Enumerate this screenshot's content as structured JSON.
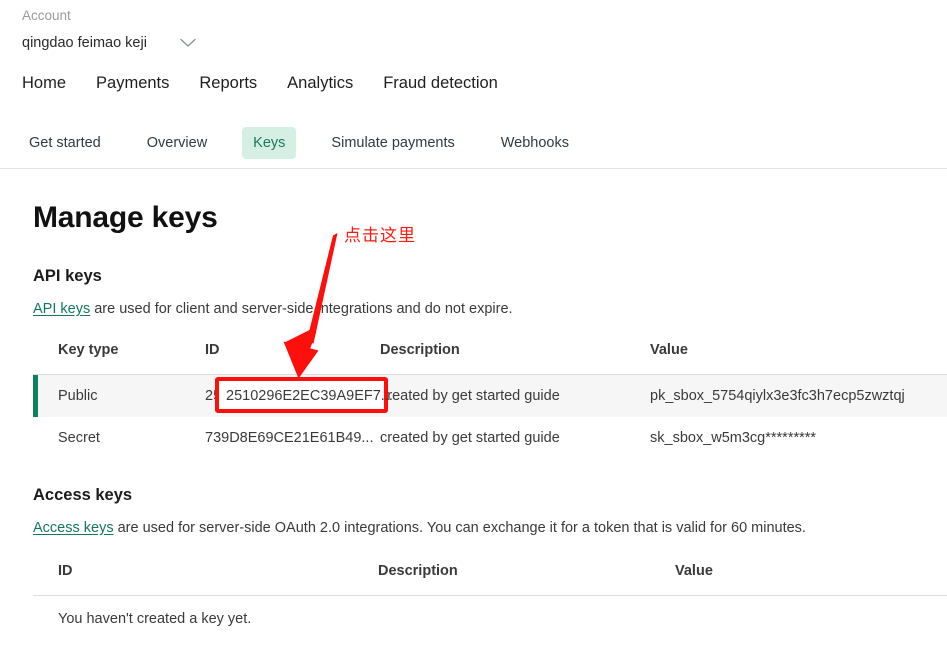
{
  "header": {
    "account_label": "Account",
    "account_name": "qingdao feimao keji",
    "chevron_icon": "chevron-down-icon"
  },
  "primary_nav": [
    {
      "label": "Home"
    },
    {
      "label": "Payments"
    },
    {
      "label": "Reports"
    },
    {
      "label": "Analytics"
    },
    {
      "label": "Fraud detection"
    }
  ],
  "tabs": [
    {
      "label": "Get started",
      "active": false
    },
    {
      "label": "Overview",
      "active": false
    },
    {
      "label": "Keys",
      "active": true
    },
    {
      "label": "Simulate payments",
      "active": false
    },
    {
      "label": "Webhooks",
      "active": false
    }
  ],
  "page_title": "Manage keys",
  "api_keys": {
    "section_title": "API keys",
    "desc_link": "API keys",
    "desc_rest": " are used for client and server-side integrations and do not expire.",
    "columns": {
      "key_type": "Key type",
      "id": "ID",
      "description": "Description",
      "value": "Value"
    },
    "rows": [
      {
        "key_type": "Public",
        "id": "2510296E2EC39A9EF7...",
        "description": "created by get started guide",
        "value": "pk_sbox_5754qiylx3e3fc3h7ecp5zwztqj",
        "highlighted": true
      },
      {
        "key_type": "Secret",
        "id": "739D8E69CE21E61B49...",
        "description": "created by get started guide",
        "value": "sk_sbox_w5m3cg*********",
        "highlighted": false
      }
    ]
  },
  "access_keys": {
    "section_title": "Access keys",
    "desc_link": "Access keys",
    "desc_rest": " are used for server-side OAuth 2.0 integrations. You can exchange it for a token that is valid for 60 minutes.",
    "columns": {
      "id": "ID",
      "description": "Description",
      "value": "Value"
    },
    "empty_message": "You haven't created a key yet."
  },
  "annotation": {
    "text": "点击这里",
    "arrow_icon": "red-arrow-down-left-icon",
    "highlight_target": "2510296E2EC39A9EF7...",
    "accent_color": "#fd0f0b"
  },
  "colors": {
    "tab_active_bg": "#d6efe5",
    "tab_active_text": "#16795c",
    "link": "#13795b",
    "row_accent": "#0f8060",
    "row_highlight_bg": "#f6f6f6",
    "annotation_red": "#fd0f0b"
  }
}
